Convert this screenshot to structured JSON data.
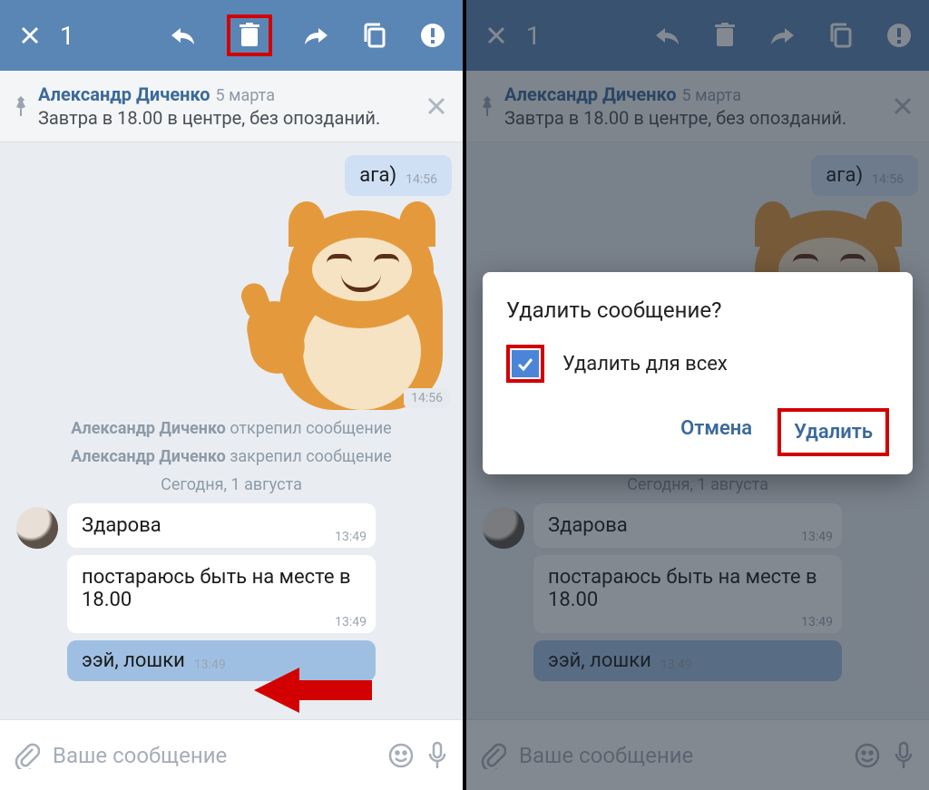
{
  "toolbar": {
    "count": "1"
  },
  "pinned": {
    "name": "Александр Диченко",
    "date": "5 марта",
    "text": "Завтра в 18.00 в центре, без опозданий."
  },
  "messages": {
    "out1": {
      "text": "ага)",
      "time": "14:56"
    },
    "sticker": {
      "time": "14:56"
    },
    "sys1_name": "Александр Диченко",
    "sys1_action": " открепил сообщение",
    "sys2_name": "Александр Диченко",
    "sys2_action": " закрепил сообщение",
    "date_separator": "Сегодня, 1 августа",
    "in1": {
      "text": "Здарова",
      "time": "13:49"
    },
    "in2": {
      "text": "постараюсь быть на месте в 18.00",
      "time": "13:49"
    },
    "in3": {
      "text": "ээй, лошки",
      "time": "13:49"
    }
  },
  "input": {
    "placeholder": "Ваше сообщение"
  },
  "dialog": {
    "title": "Удалить сообщение?",
    "checkbox_label": "Удалить для всех",
    "checkbox_checked": true,
    "cancel": "Отмена",
    "confirm": "Удалить"
  }
}
